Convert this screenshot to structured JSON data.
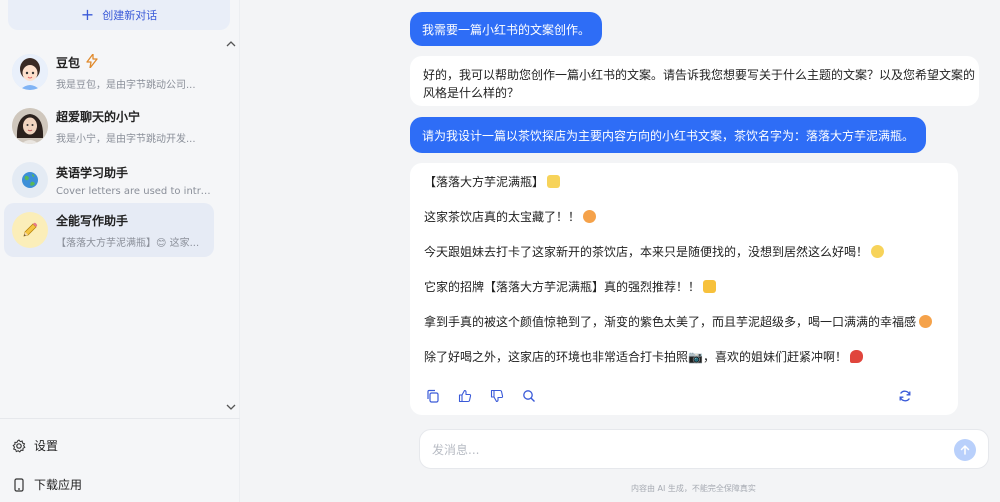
{
  "sidebar": {
    "new_chat_label": "创建新对话",
    "conversations": [
      {
        "name": "豆包",
        "preview": "我是豆包，是由字节跳动公司..."
      },
      {
        "name": "超爱聊天的小宁",
        "preview": "我是小宁，是由字节跳动开发..."
      },
      {
        "name": "英语学习助手",
        "preview": "Cover letters are used to introd..."
      },
      {
        "name": "全能写作助手",
        "preview": "【落落大方芋泥满瓶】😊 这家..."
      }
    ],
    "footer": {
      "settings_label": "设置",
      "download_label": "下载应用"
    }
  },
  "chat": {
    "messages": [
      {
        "role": "user",
        "text": "我需要一篇小红书的文案创作。"
      },
      {
        "role": "assistant",
        "lines": [
          "好的，我可以帮助您创作一篇小红书的文案。请告诉我您想要写关于什么主题的文案？以及您希望文案的",
          "风格是什么样的？"
        ]
      },
      {
        "role": "user",
        "text": "请为我设计一篇以茶饮探店为主要内容方向的小红书文案，茶饮名字为：落落大方芋泥满瓶。"
      },
      {
        "role": "assistant",
        "lines": [
          "【落落大方芋泥满瓶】",
          "这家茶饮店真的太宝藏了！！",
          "今天跟姐妹去打卡了这家新开的茶饮店，本来只是随便找的，没想到居然这么好喝！",
          "它家的招牌【落落大方芋泥满瓶】真的强烈推荐！！",
          "拿到手真的被这个颜值惊艳到了，渐变的紫色太美了，而且芋泥超级多，喝一口满满的幸福感",
          "除了好喝之外，这家店的环境也非常适合打卡拍照📷，喜欢的姐妹们赶紧冲啊！"
        ]
      }
    ]
  },
  "input": {
    "placeholder": "发消息..."
  },
  "disclaimer": "内容由 AI 生成，不能完全保障真实",
  "colors": {
    "accent": "#2e6df6",
    "sidebar_bg": "#f5f6f8",
    "active_bg": "#e6ebf5"
  }
}
